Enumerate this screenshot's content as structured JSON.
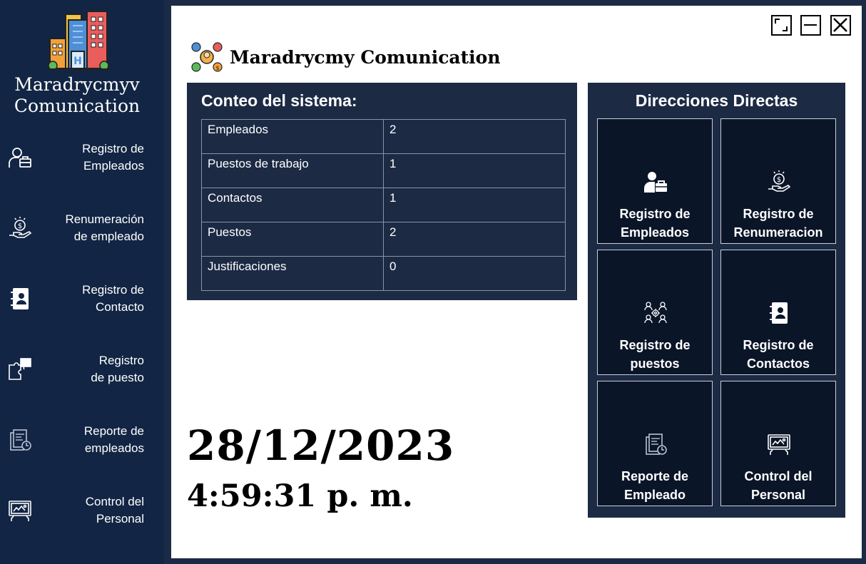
{
  "sidebar": {
    "app_name_line1": "Maradrycmyv",
    "app_name_line2": "Comunication",
    "items": [
      {
        "label": "Registro de\nEmpleados",
        "icon": "employee-briefcase-icon"
      },
      {
        "label": "Renumeración\nde empleado",
        "icon": "salary-hand-icon"
      },
      {
        "label": "Registro de\nContacto",
        "icon": "contact-book-icon"
      },
      {
        "label": "Registro\nde puesto",
        "icon": "puzzle-icon"
      },
      {
        "label": "Reporte de\nempleados",
        "icon": "report-icon"
      },
      {
        "label": "Control del\nPersonal",
        "icon": "monitor-control-icon"
      }
    ]
  },
  "header": {
    "title": "Maradrycmy Comunication"
  },
  "counts": {
    "title": "Conteo del sistema:",
    "rows": [
      {
        "label": "Empleados",
        "value": "2"
      },
      {
        "label": "Puestos de trabajo",
        "value": "1"
      },
      {
        "label": "Contactos",
        "value": "1"
      },
      {
        "label": "Puestos",
        "value": "2"
      },
      {
        "label": "Justificaciones",
        "value": "0"
      }
    ]
  },
  "datetime": {
    "date": "28/12/2023",
    "time": "4:59:31 p. m."
  },
  "shortcuts": {
    "title": "Direcciones Directas",
    "tiles": [
      {
        "label": "Registro de\nEmpleados",
        "icon": "employee-briefcase-icon"
      },
      {
        "label": "Registro de\nRenumeracion",
        "icon": "salary-hand-icon"
      },
      {
        "label": "Registro de\npuestos",
        "icon": "team-gear-icon"
      },
      {
        "label": "Registro de\nContactos",
        "icon": "contact-book-icon"
      },
      {
        "label": "Reporte de\nEmpleado",
        "icon": "report-icon"
      },
      {
        "label": "Control del\nPersonal",
        "icon": "monitor-control-icon"
      }
    ]
  },
  "colors": {
    "sidebar_bg": "#122544",
    "panel_bg": "#1c2a44",
    "tile_bg": "#0a1528"
  }
}
